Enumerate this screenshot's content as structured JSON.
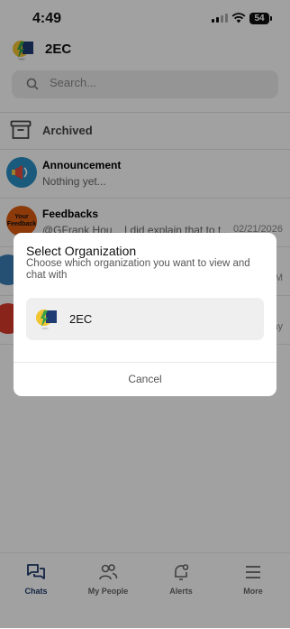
{
  "status_bar": {
    "time": "4:49",
    "battery": "54"
  },
  "header": {
    "org_name": "2EC"
  },
  "search": {
    "placeholder": "Search..."
  },
  "archived": {
    "label": "Archived"
  },
  "chats": [
    {
      "name": "Announcement",
      "preview": "Nothing yet...",
      "date": ""
    },
    {
      "name": "Feedbacks",
      "preview": "@GFrank Hou...  I did explain that to t...",
      "date": "02/21/2026",
      "avatar_text": "Your Feedback"
    },
    {
      "name": "",
      "preview": "",
      "date": "M"
    },
    {
      "name": "",
      "preview": "",
      "date": "ay"
    }
  ],
  "nav": [
    {
      "label": "Chats",
      "icon": "chats-icon",
      "active": true
    },
    {
      "label": "My People",
      "icon": "people-icon",
      "active": false
    },
    {
      "label": "Alerts",
      "icon": "bell-icon",
      "active": false
    },
    {
      "label": "More",
      "icon": "menu-icon",
      "active": false
    }
  ],
  "modal": {
    "title": "Select Organization",
    "subtitle": "Choose which organization you want to view and chat with",
    "option_name": "2EC",
    "cancel_label": "Cancel"
  },
  "colors": {
    "accent": "#1e3a6b",
    "overlay": "#000000",
    "modal_bg": "#ffffff",
    "option_bg": "#efefef",
    "logo_yellow": "#f2c531",
    "logo_navy": "#1f3b73",
    "logo_green": "#3aa14b"
  }
}
